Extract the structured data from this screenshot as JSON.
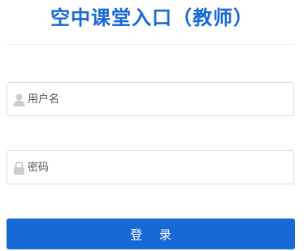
{
  "header": {
    "title": "空中课堂入口（教师）"
  },
  "form": {
    "username": {
      "icon": "user-icon",
      "placeholder": "用户名",
      "value": ""
    },
    "password": {
      "icon": "lock-icon",
      "placeholder": "密码",
      "value": ""
    },
    "submit_label": "登 录"
  },
  "colors": {
    "accent": "#1769d6",
    "border": "#d9dbde",
    "icon": "#cccccc"
  }
}
